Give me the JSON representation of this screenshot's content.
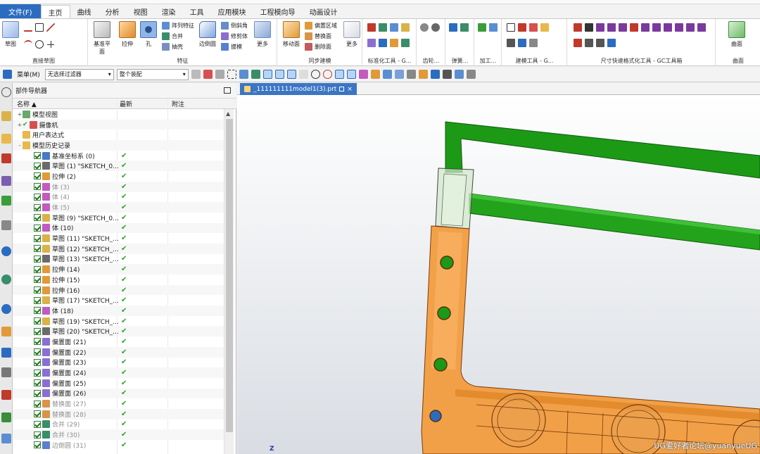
{
  "menubar": {
    "tabs": [
      "文件(F)",
      "主页",
      "曲线",
      "分析",
      "视图",
      "渲染",
      "工具",
      "应用模块",
      "工程模向导",
      "动画设计"
    ],
    "active_index": 1
  },
  "ribbon": {
    "sketch_label": "草图",
    "direct_sketch_label": "直接草图",
    "datum_plane_label": "基准平面",
    "extrude_label": "拉伸",
    "hole_label": "孔",
    "pattern_feature_label": "阵列特征",
    "unite_label": "合并",
    "shell_label": "抽壳",
    "edge_blend_label": "边倒圆",
    "chamfer_label": "倒斜角",
    "trim_body_label": "修剪体",
    "draft_label": "拔模",
    "more_label": "更多",
    "feature_group_label": "特征",
    "move_face_label": "移动面",
    "offset_region_label": "偏置区域",
    "replace_face_label": "替换面",
    "delete_face_label": "删除面",
    "sync_more_label": "更多",
    "sync_group_label": "同步建模",
    "standard_tools_label": "标准化工具 - G...",
    "gear_label": "齿轮...",
    "spring_label": "弹簧...",
    "machining_label": "加工...",
    "modeling_tools_label": "建模工具 - G...",
    "dim_tools_label": "尺寸快速格式化工具 - GC工具箱",
    "surface_label": "曲面",
    "surface_group_label": "曲面"
  },
  "seltool": {
    "menu_label": "菜单(M)",
    "filter_value": "无选择过滤器",
    "scope_value": "整个装配"
  },
  "navigator": {
    "title": "部件导航器",
    "col_name": "名称",
    "col_latest": "最新",
    "col_note": "附注",
    "rows": [
      {
        "label": "模型视图",
        "level": 0,
        "exp": "+",
        "cb": false,
        "icon": "#6aa86a",
        "grey": false,
        "tick": false
      },
      {
        "label": "摄像机",
        "level": 0,
        "exp": "+",
        "cb": false,
        "icon": "#d94f4f",
        "grey": false,
        "tick": false,
        "check": true
      },
      {
        "label": "用户表达式",
        "level": 0,
        "exp": "",
        "cb": false,
        "icon": "#e8b84a",
        "grey": false,
        "tick": false
      },
      {
        "label": "模型历史记录",
        "level": 0,
        "exp": "-",
        "cb": false,
        "icon": "#e8b84a",
        "grey": false,
        "tick": false
      },
      {
        "label": "基准坐标系 (0)",
        "level": 1,
        "cb": true,
        "icon": "#4a78c7",
        "grey": false,
        "tick": true
      },
      {
        "label": "草图 (1) \"SKETCH_0...",
        "level": 1,
        "cb": true,
        "icon": "#6b6b6b",
        "grey": false,
        "tick": true
      },
      {
        "label": "拉伸 (2)",
        "level": 1,
        "cb": true,
        "icon": "#e09a3a",
        "grey": false,
        "tick": true
      },
      {
        "label": "体 (3)",
        "level": 1,
        "cb": true,
        "icon": "#c25bbf",
        "grey": true,
        "tick": true
      },
      {
        "label": "体 (4)",
        "level": 1,
        "cb": true,
        "icon": "#c25bbf",
        "grey": true,
        "tick": true
      },
      {
        "label": "体 (5)",
        "level": 1,
        "cb": true,
        "icon": "#c25bbf",
        "grey": true,
        "tick": true
      },
      {
        "label": "草图 (9) \"SKETCH_0...",
        "level": 1,
        "cb": true,
        "icon": "#d9b24a",
        "grey": false,
        "tick": true
      },
      {
        "label": "体 (10)",
        "level": 1,
        "cb": true,
        "icon": "#c25bbf",
        "grey": false,
        "tick": true
      },
      {
        "label": "草图 (11) \"SKETCH_...",
        "level": 1,
        "cb": true,
        "icon": "#d9b24a",
        "grey": false,
        "tick": true
      },
      {
        "label": "草图 (12) \"SKETCH_...",
        "level": 1,
        "cb": true,
        "icon": "#d9b24a",
        "grey": false,
        "tick": true
      },
      {
        "label": "草图 (13) \"SKETCH_...",
        "level": 1,
        "cb": true,
        "icon": "#6b6b6b",
        "grey": false,
        "tick": true
      },
      {
        "label": "拉伸 (14)",
        "level": 1,
        "cb": true,
        "icon": "#e09a3a",
        "grey": false,
        "tick": true
      },
      {
        "label": "拉伸 (15)",
        "level": 1,
        "cb": true,
        "icon": "#e09a3a",
        "grey": false,
        "tick": true
      },
      {
        "label": "拉伸 (16)",
        "level": 1,
        "cb": true,
        "icon": "#e09a3a",
        "grey": false,
        "tick": true
      },
      {
        "label": "草图 (17) \"SKETCH_...",
        "level": 1,
        "cb": true,
        "icon": "#d9b24a",
        "grey": false,
        "tick": true
      },
      {
        "label": "体 (18)",
        "level": 1,
        "cb": true,
        "icon": "#c25bbf",
        "grey": false,
        "tick": true
      },
      {
        "label": "草图 (19) \"SKETCH_...",
        "level": 1,
        "cb": true,
        "icon": "#d9b24a",
        "grey": false,
        "tick": true
      },
      {
        "label": "草图 (20) \"SKETCH_...",
        "level": 1,
        "cb": true,
        "icon": "#6b6b6b",
        "grey": false,
        "tick": true
      },
      {
        "label": "偏置面 (21)",
        "level": 1,
        "cb": true,
        "icon": "#8a6fd1",
        "grey": false,
        "tick": true
      },
      {
        "label": "偏置面 (22)",
        "level": 1,
        "cb": true,
        "icon": "#8a6fd1",
        "grey": false,
        "tick": true
      },
      {
        "label": "偏置面 (23)",
        "level": 1,
        "cb": true,
        "icon": "#8a6fd1",
        "grey": false,
        "tick": true
      },
      {
        "label": "偏置面 (24)",
        "level": 1,
        "cb": true,
        "icon": "#8a6fd1",
        "grey": false,
        "tick": true
      },
      {
        "label": "偏置面 (25)",
        "level": 1,
        "cb": true,
        "icon": "#8a6fd1",
        "grey": false,
        "tick": true
      },
      {
        "label": "偏置面 (26)",
        "level": 1,
        "cb": true,
        "icon": "#8a6fd1",
        "grey": false,
        "tick": true
      },
      {
        "label": "替换面 (27)",
        "level": 1,
        "cb": true,
        "icon": "#d9944a",
        "grey": true,
        "tick": true
      },
      {
        "label": "替换面 (28)",
        "level": 1,
        "cb": true,
        "icon": "#d9944a",
        "grey": true,
        "tick": true
      },
      {
        "label": "合并 (29)",
        "level": 1,
        "cb": true,
        "icon": "#3a8d6a",
        "grey": true,
        "tick": true
      },
      {
        "label": "合并 (30)",
        "level": 1,
        "cb": true,
        "icon": "#3a8d6a",
        "grey": true,
        "tick": true
      },
      {
        "label": "边倒圆 (31)",
        "level": 1,
        "cb": true,
        "icon": "#5a7fd1",
        "grey": true,
        "tick": true
      }
    ]
  },
  "document": {
    "tab_label": "_111111111model1(3).prt",
    "close_glyph": "×"
  },
  "viewport": {
    "watermark": "UG爱好者论坛@yuanyueUG",
    "triad_label": "Z",
    "colors": {
      "green_body": "#1c9a16",
      "orange_body": "#f39a3a"
    }
  },
  "tick_glyph": "✔"
}
